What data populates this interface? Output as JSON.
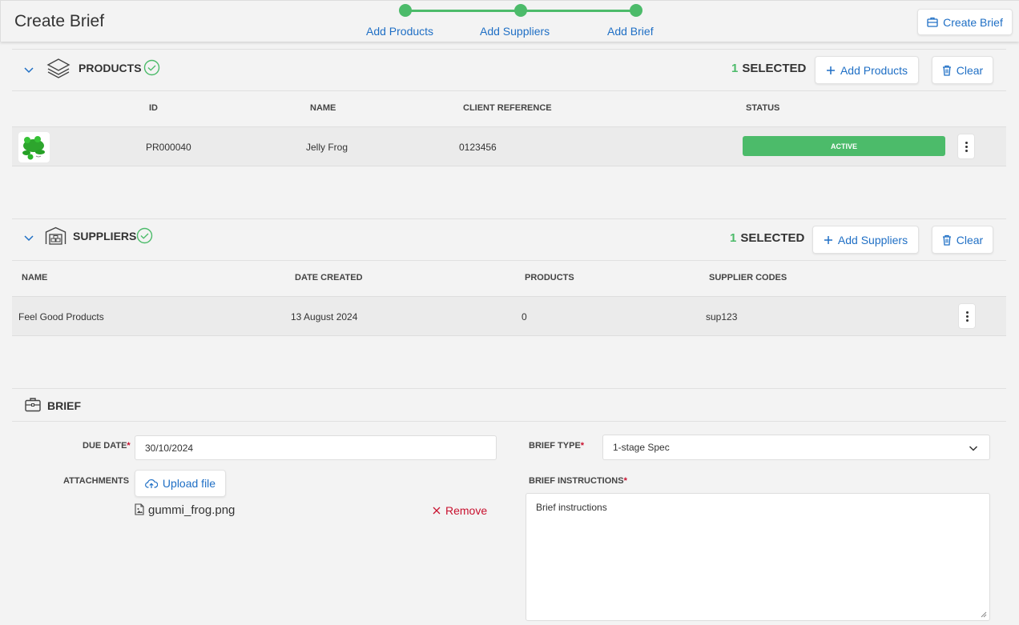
{
  "header": {
    "title": "Create Brief",
    "steps": [
      "Add Products",
      "Add Suppliers",
      "Add Brief"
    ],
    "create_button": "Create Brief"
  },
  "products": {
    "title": "PRODUCTS",
    "selected_count": "1",
    "selected_label": "SELECTED",
    "add_button": "Add Products",
    "clear_button": "Clear",
    "columns": [
      "ID",
      "NAME",
      "CLIENT REFERENCE",
      "STATUS"
    ],
    "rows": [
      {
        "id": "PR000040",
        "name": "Jelly Frog",
        "client_reference": "0123456",
        "status": "ACTIVE"
      }
    ]
  },
  "suppliers": {
    "title": "SUPPLIERS",
    "selected_count": "1",
    "selected_label": "SELECTED",
    "add_button": "Add Suppliers",
    "clear_button": "Clear",
    "columns": [
      "NAME",
      "DATE CREATED",
      "PRODUCTS",
      "SUPPLIER CODES"
    ],
    "rows": [
      {
        "name": "Feel Good Products",
        "date_created": "13 August 2024",
        "products": "0",
        "supplier_codes": "sup123"
      }
    ]
  },
  "brief": {
    "title": "BRIEF",
    "due_date_label": "DUE DATE",
    "due_date_value": "30/10/2024",
    "brief_type_label": "BRIEF TYPE",
    "brief_type_value": "1-stage Spec",
    "attachments_label": "ATTACHMENTS",
    "upload_button": "Upload file",
    "attachment_filename": "gummi_frog.png",
    "remove_label": "Remove",
    "instructions_label": "BRIEF INSTRUCTIONS",
    "instructions_value": "Brief instructions",
    "required_marker": "*"
  },
  "colors": {
    "accent_green": "#4cbb6a",
    "link_blue": "#1f6fc5",
    "danger_red": "#c8102e"
  }
}
